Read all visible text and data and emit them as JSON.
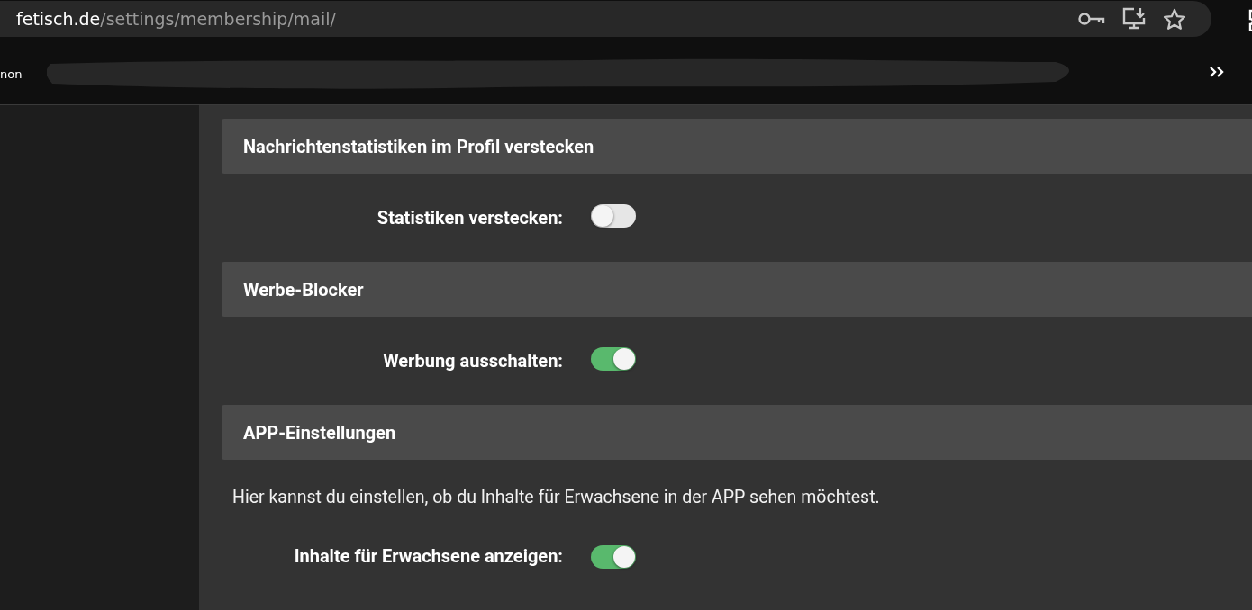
{
  "browser": {
    "url_host": "fetisch.de",
    "url_path": "/settings/membership/mail/",
    "bookmarks": [
      {
        "label": "non"
      }
    ]
  },
  "sections": [
    {
      "title": "Nachrichtenstatistiken im Profil verstecken",
      "settings": [
        {
          "label": "Statistiken verstecken:",
          "on": false
        }
      ]
    },
    {
      "title": "Werbe-Blocker",
      "settings": [
        {
          "label": "Werbung ausschalten:",
          "on": true
        }
      ]
    },
    {
      "title": "APP-Einstellungen",
      "description": "Hier kannst du einstellen, ob du Inhalte für Erwachsene in der APP sehen möchtest.",
      "settings": [
        {
          "label": "Inhalte für Erwachsene anzeigen:",
          "on": true
        }
      ]
    }
  ]
}
